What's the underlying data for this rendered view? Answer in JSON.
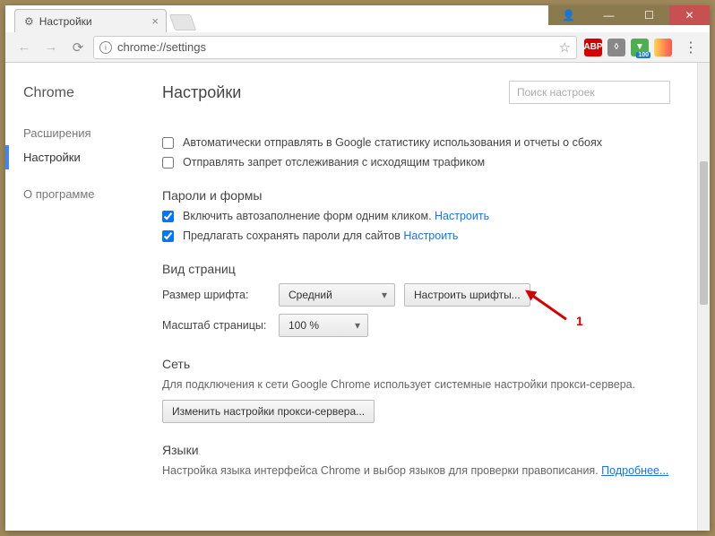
{
  "tab": {
    "title": "Настройки"
  },
  "url": "chrome://settings",
  "sidebar": {
    "brand": "Chrome",
    "items": [
      "Расширения",
      "Настройки"
    ],
    "about": "О программе"
  },
  "header": {
    "title": "Настройки",
    "search_placeholder": "Поиск настроек"
  },
  "privacy": {
    "stats": "Автоматически отправлять в Google статистику использования и отчеты о сбоях",
    "dnt": "Отправлять запрет отслеживания с исходящим трафиком"
  },
  "passwords": {
    "section": "Пароли и формы",
    "autofill": "Включить автозаполнение форм одним кликом.",
    "autofill_link": "Настроить",
    "offer_save": "Предлагать сохранять пароли для сайтов",
    "offer_link": "Настроить"
  },
  "appearance": {
    "section": "Вид страниц",
    "font_label": "Размер шрифта:",
    "font_value": "Средний",
    "font_button": "Настроить шрифты...",
    "zoom_label": "Масштаб страницы:",
    "zoom_value": "100 %"
  },
  "network": {
    "section": "Сеть",
    "desc": "Для подключения к сети Google Chrome использует системные настройки прокси-сервера.",
    "button": "Изменить настройки прокси-сервера..."
  },
  "languages": {
    "section": "Языки",
    "desc": "Настройка языка интерфейса Chrome и выбор языков для проверки правописания.",
    "link": "Подробнее..."
  },
  "annotation": {
    "label": "1"
  },
  "ext_icons": {
    "abp": "ABP",
    "shield": "shield-icon",
    "download": "download-icon",
    "bookmark": "bookmark-icon"
  }
}
